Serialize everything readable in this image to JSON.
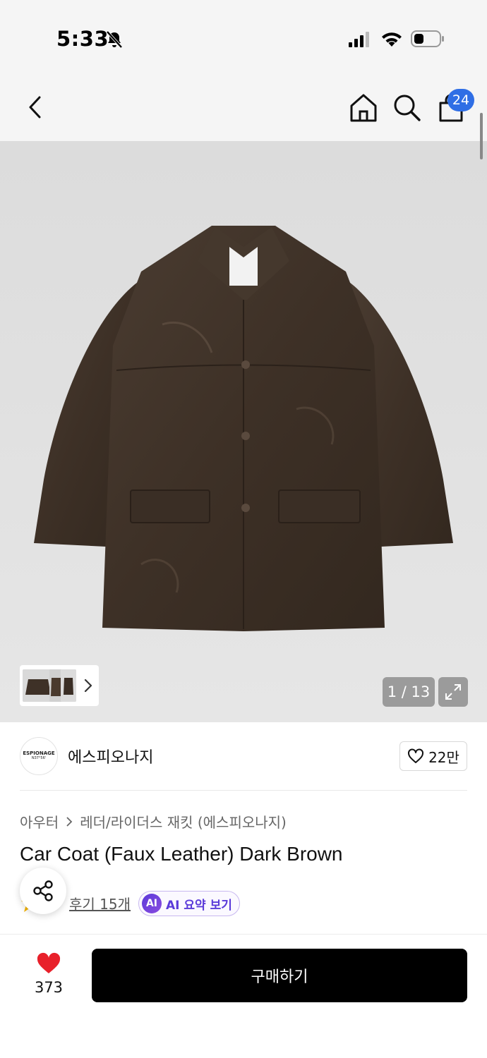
{
  "status_bar": {
    "time": "5:33"
  },
  "header": {
    "cart_count": "24"
  },
  "gallery": {
    "page_counter": "1 / 13"
  },
  "brand": {
    "logo_text": "ESPIONAGE",
    "logo_sub": "N37°56'",
    "name": "에스피오나지",
    "like_count": "22만"
  },
  "breadcrumb": {
    "category": "아우터",
    "subcategory": "레더/라이더스 재킷 (에스피오나지)"
  },
  "product": {
    "title": "Car Coat (Faux Leather) Dark Brown",
    "review_link": "후기 15개",
    "ai_badge": "AI",
    "ai_summary_label": "AI 요약 보기"
  },
  "bottom_bar": {
    "like_count": "373",
    "buy_label": "구매하기"
  },
  "colors": {
    "buy_button": "#000000",
    "cart_badge": "#2f6ee5",
    "heart": "#e8202a",
    "ai_accent": "#5b3bd9",
    "jacket": "#3e3127"
  }
}
